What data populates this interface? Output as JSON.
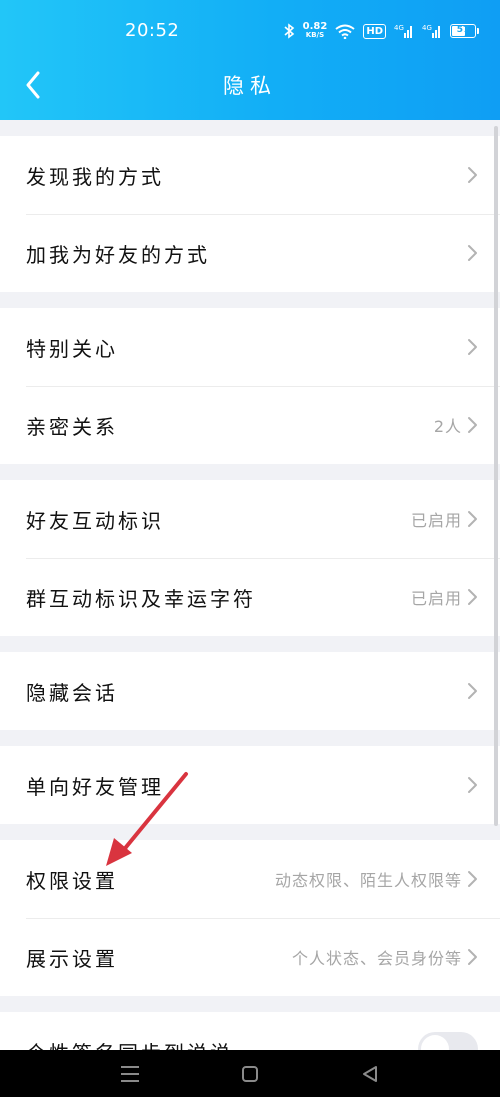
{
  "status_bar": {
    "time": "20:52",
    "net_speed_value": "0.82",
    "net_speed_unit": "KB/S",
    "hd_label": "HD",
    "signal_1": "4G",
    "signal_2": "4G",
    "battery": "57"
  },
  "header": {
    "title": "隐私"
  },
  "rows": {
    "discover": {
      "label": "发现我的方式"
    },
    "add_friend": {
      "label": "加我为好友的方式"
    },
    "special_care": {
      "label": "特别关心"
    },
    "intimate": {
      "label": "亲密关系",
      "value": "2人"
    },
    "friend_interaction": {
      "label": "好友互动标识",
      "value": "已启用"
    },
    "group_interaction": {
      "label": "群互动标识及幸运字符",
      "value": "已启用"
    },
    "hidden_chats": {
      "label": "隐藏会话"
    },
    "one_way_friends": {
      "label": "单向好友管理"
    },
    "permissions": {
      "label": "权限设置",
      "value": "动态权限、陌生人权限等"
    },
    "display": {
      "label": "展示设置",
      "value": "个人状态、会员身份等"
    },
    "signature_sync": {
      "label": "个性签名同步到说说"
    }
  },
  "colors": {
    "header_start": "#22c6f8",
    "header_end": "#0f9ef4",
    "annotation_arrow": "#d9343f"
  },
  "icons": {
    "back": "chevron-left-icon",
    "row_arrow": "chevron-right-icon",
    "nav_menu": "menu-icon",
    "nav_home": "home-square-icon",
    "nav_back": "triangle-back-icon"
  }
}
